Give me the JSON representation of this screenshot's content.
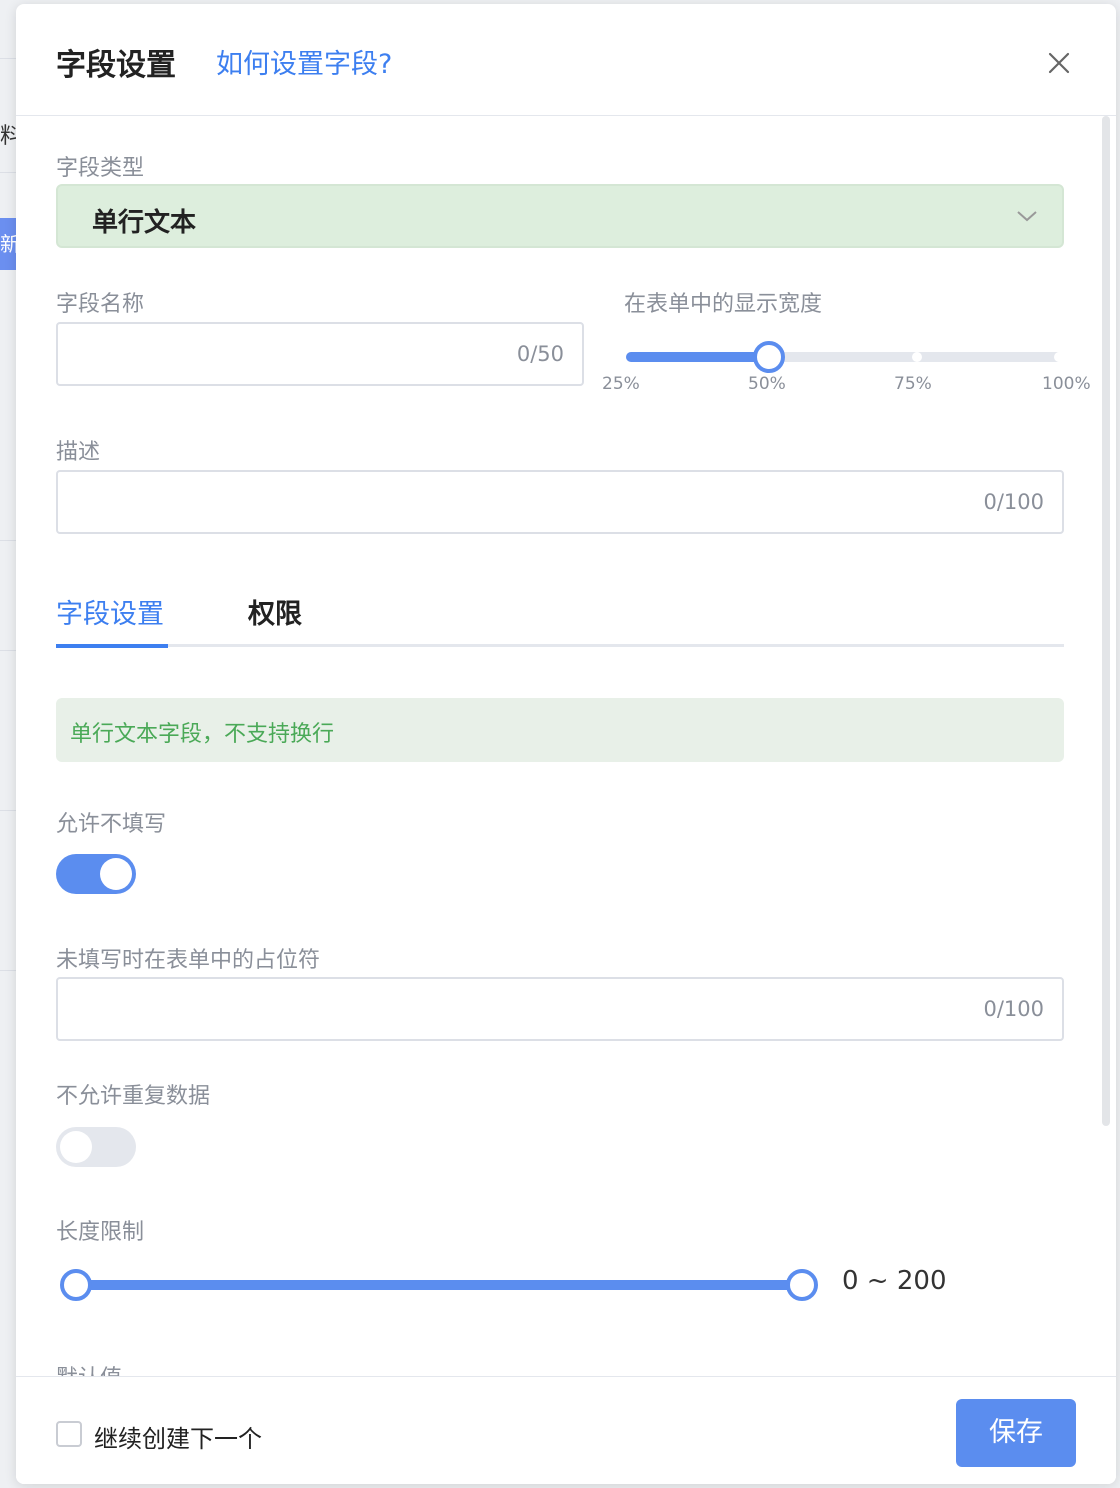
{
  "background": {
    "partial_text": "料/",
    "badge_text": "新"
  },
  "modal": {
    "title": "字段设置",
    "help_link": "如何设置字段?",
    "close_icon": "close-icon"
  },
  "field_type": {
    "label": "字段类型",
    "value": "单行文本",
    "arrow_icon": "chevron-down-icon"
  },
  "field_name": {
    "label": "字段名称",
    "value": "",
    "counter": "0/50"
  },
  "display_width": {
    "label": "在表单中的显示宽度",
    "marks": [
      "25%",
      "50%",
      "75%",
      "100%"
    ],
    "selected": "50%"
  },
  "description": {
    "label": "描述",
    "value": "",
    "counter": "0/100"
  },
  "tabs": [
    {
      "label": "字段设置",
      "active": true
    },
    {
      "label": "权限",
      "active": false
    }
  ],
  "notice": {
    "text": "单行文本字段，不支持换行"
  },
  "allow_empty": {
    "label": "允许不填写",
    "on": true
  },
  "placeholder_setting": {
    "label": "未填写时在表单中的占位符",
    "value": "",
    "counter": "0/100"
  },
  "no_duplicate": {
    "label": "不允许重复数据",
    "on": false
  },
  "length_limit": {
    "label": "长度限制",
    "min": 0,
    "max": 200,
    "range_text": "0 ~ 200"
  },
  "default_value": {
    "label": "默认值"
  },
  "footer": {
    "checkbox_label": "继续创建下一个",
    "checked": false,
    "save_label": "保存"
  },
  "colors": {
    "accent": "#3d7ff0",
    "slider": "#5b8def",
    "notice_text": "#4aa957",
    "select_bg": "#ddeedd"
  }
}
